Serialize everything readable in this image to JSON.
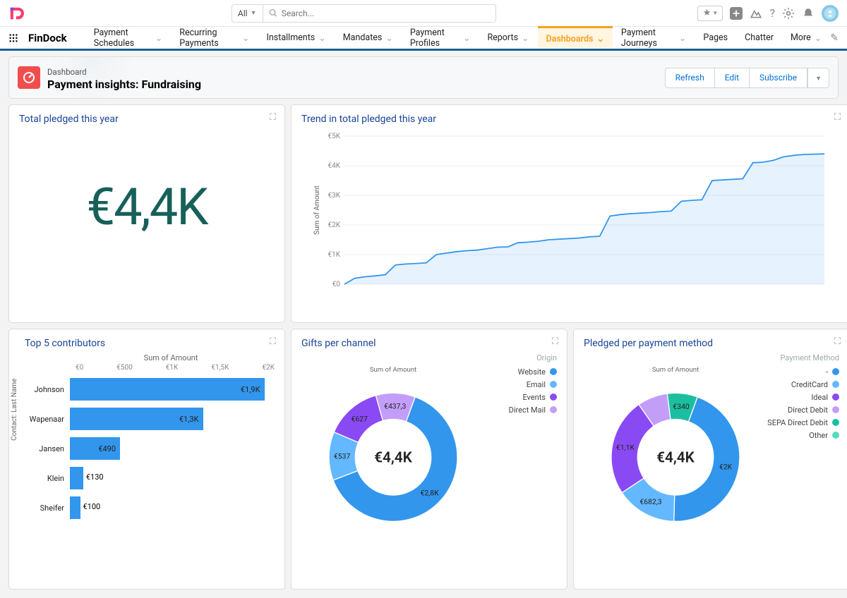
{
  "global": {
    "filter_scope": "All",
    "search_placeholder": "Search..."
  },
  "nav": {
    "app_name": "FinDock",
    "items": [
      "Payment Schedules",
      "Recurring Payments",
      "Installments",
      "Mandates",
      "Payment Profiles",
      "Reports",
      "Dashboards",
      "Payment Journeys",
      "Pages",
      "Chatter",
      "More"
    ],
    "active": "Dashboards"
  },
  "header": {
    "eyebrow": "Dashboard",
    "title": "Payment insights: Fundraising",
    "actions": {
      "refresh": "Refresh",
      "edit": "Edit",
      "subscribe": "Subscribe"
    }
  },
  "cards": {
    "total_pledged": {
      "title": "Total pledged this year",
      "value": "€4,4K"
    },
    "trend": {
      "title": "Trend in total pledged this year",
      "ylabel": "Sum of Amount"
    },
    "top5": {
      "title": "Top 5 contributors",
      "sub": "Sum of Amount",
      "ylabel": "Contact: Last Name"
    },
    "gifts": {
      "title": "Gifts per channel",
      "sub": "Sum of Amount",
      "legend_title": "Origin",
      "center": "€4,4K"
    },
    "pledged_pm": {
      "title": "Pledged per payment method",
      "sub": "Sum of Amount",
      "legend_title": "Payment Method",
      "center": "€4,4K"
    }
  },
  "chart_data": [
    {
      "id": "trend",
      "type": "area",
      "ylabel": "Sum of Amount",
      "ylim": [
        0,
        5000
      ],
      "yticks": [
        "€0",
        "€1K",
        "€2K",
        "€3K",
        "€4K",
        "€5K"
      ],
      "values": [
        0,
        200,
        250,
        280,
        320,
        650,
        680,
        700,
        720,
        1000,
        1050,
        1100,
        1130,
        1150,
        1200,
        1250,
        1260,
        1400,
        1420,
        1450,
        1500,
        1520,
        1540,
        1560,
        1600,
        1620,
        2300,
        2350,
        2380,
        2400,
        2420,
        2450,
        2470,
        2800,
        2830,
        2850,
        3500,
        3520,
        3540,
        3560,
        4100,
        4120,
        4180,
        4300,
        4350,
        4380,
        4390,
        4400
      ]
    },
    {
      "id": "top5",
      "type": "bar",
      "orientation": "horizontal",
      "xlabel": "Sum of Amount",
      "ylabel": "Contact: Last Name",
      "xlim": [
        0,
        2000
      ],
      "xticks": [
        "€0",
        "€500",
        "€1K",
        "€1,5K",
        "€2K"
      ],
      "categories": [
        "Johnson",
        "Wapenaar",
        "Jansen",
        "Klein",
        "Sheifer"
      ],
      "values": [
        1900,
        1300,
        490,
        130,
        100
      ],
      "value_labels": [
        "€1,9K",
        "€1,3K",
        "€490",
        "€130",
        "€100"
      ]
    },
    {
      "id": "gifts_per_channel",
      "type": "donut",
      "title": "Sum of Amount",
      "center_label": "€4,4K",
      "series": [
        {
          "name": "Website",
          "value": 2800,
          "label": "€2,8K",
          "color": "#3296ed"
        },
        {
          "name": "Email",
          "value": 537,
          "label": "€537",
          "color": "#63b8ff"
        },
        {
          "name": "Events",
          "value": 627,
          "label": "€627",
          "color": "#8a4af3"
        },
        {
          "name": "Direct Mail",
          "value": 437.3,
          "label": "€437,3",
          "color": "#c39ef9"
        }
      ]
    },
    {
      "id": "pledged_per_payment_method",
      "type": "donut",
      "title": "Sum of Amount",
      "center_label": "€4,4K",
      "series": [
        {
          "name": "-",
          "value": 2000,
          "label": "€2K",
          "color": "#3296ed"
        },
        {
          "name": "CreditCard",
          "value": 682.3,
          "label": "€682,3",
          "color": "#63b8ff"
        },
        {
          "name": "Ideal",
          "value": 1100,
          "label": "€1,1K",
          "color": "#8a4af3"
        },
        {
          "name": "Direct Debit",
          "value": 340,
          "label": "",
          "color": "#c39ef9"
        },
        {
          "name": "SEPA Direct Debit",
          "value": 340,
          "label": "€340",
          "color": "#1bbfa0"
        },
        {
          "name": "Other",
          "value": 0,
          "label": "",
          "color": "#57d9c1"
        }
      ]
    }
  ]
}
